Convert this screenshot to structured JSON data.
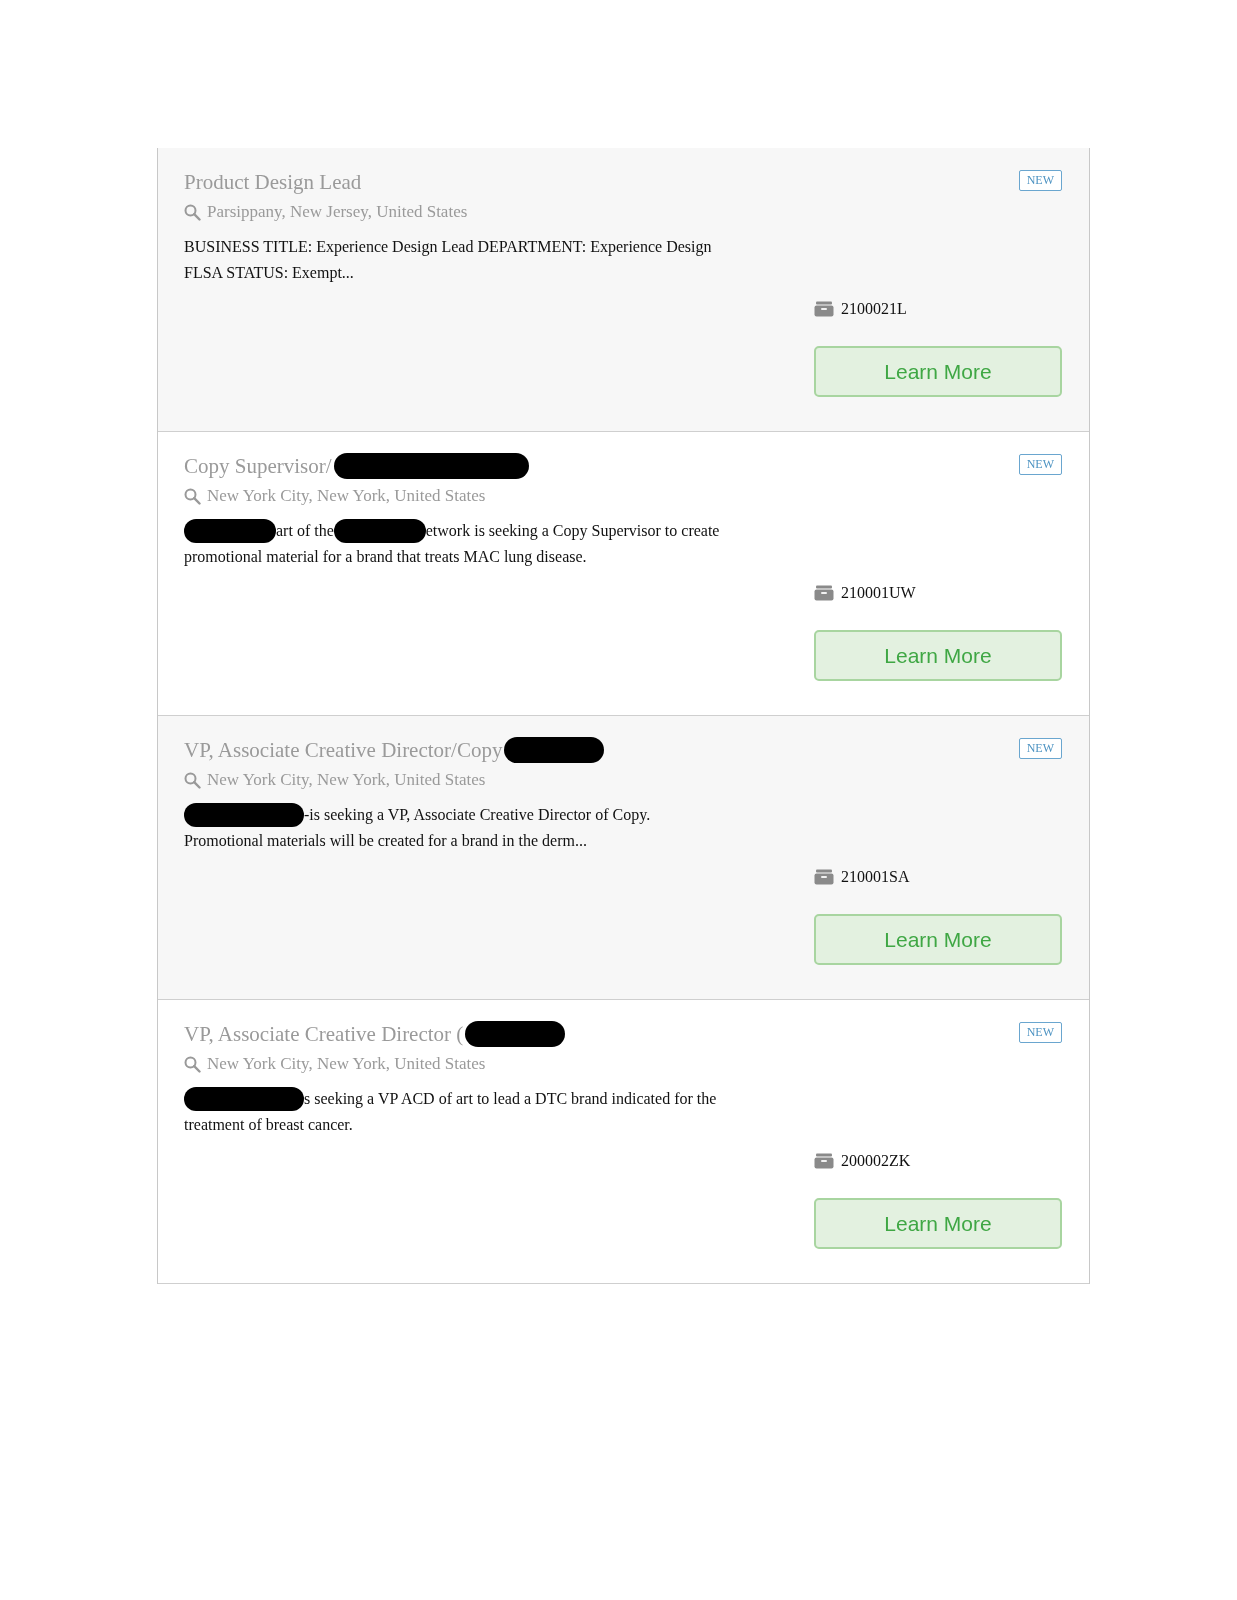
{
  "jobs": [
    {
      "title": [
        {
          "kind": "text",
          "text": "Product Design Lead"
        }
      ],
      "location": "Parsippany, New Jersey, United States",
      "badge": "NEW",
      "description": [
        [
          {
            "kind": "text",
            "text": "BUSINESS TITLE: Experience Design Lead DEPARTMENT: Experience Design"
          }
        ],
        [
          {
            "kind": "text",
            "text": "FLSA STATUS: Exempt..."
          }
        ]
      ],
      "job_id": "2100021L",
      "button": "Learn More"
    },
    {
      "title": [
        {
          "kind": "text",
          "text": "Copy Supervisor/"
        },
        {
          "kind": "redaction"
        }
      ],
      "location": "New York City, New York, United States",
      "badge": "NEW",
      "description": [
        [
          {
            "kind": "redaction"
          },
          {
            "kind": "text",
            "text": "art of the"
          },
          {
            "kind": "redaction"
          },
          {
            "kind": "text",
            "text": "etwork is seeking a Copy Supervisor to create"
          }
        ],
        [
          {
            "kind": "text",
            "text": "promotional material for a brand that treats MAC lung disease."
          }
        ]
      ],
      "job_id": "210001UW",
      "button": "Learn More"
    },
    {
      "title": [
        {
          "kind": "text",
          "text": "VP, Associate Creative Director/Copy"
        },
        {
          "kind": "redaction"
        }
      ],
      "location": "New York City, New York, United States",
      "badge": "NEW",
      "description": [
        [
          {
            "kind": "redaction"
          },
          {
            "kind": "text",
            "text": "-is seeking a VP, Associate Creative Director of Copy."
          }
        ],
        [
          {
            "kind": "text",
            "text": "Promotional materials will be created for a brand in the derm..."
          }
        ]
      ],
      "job_id": "210001SA",
      "button": "Learn More"
    },
    {
      "title": [
        {
          "kind": "text",
          "text": "VP, Associate Creative Director ("
        },
        {
          "kind": "redaction"
        }
      ],
      "location": "New York City, New York, United States",
      "badge": "NEW",
      "description": [
        [
          {
            "kind": "redaction"
          },
          {
            "kind": "text",
            "text": "s seeking a VP ACD of art to lead a DTC brand indicated for the"
          }
        ],
        [
          {
            "kind": "text",
            "text": "treatment of breast cancer."
          }
        ]
      ],
      "job_id": "200002ZK",
      "button": "Learn More"
    }
  ]
}
